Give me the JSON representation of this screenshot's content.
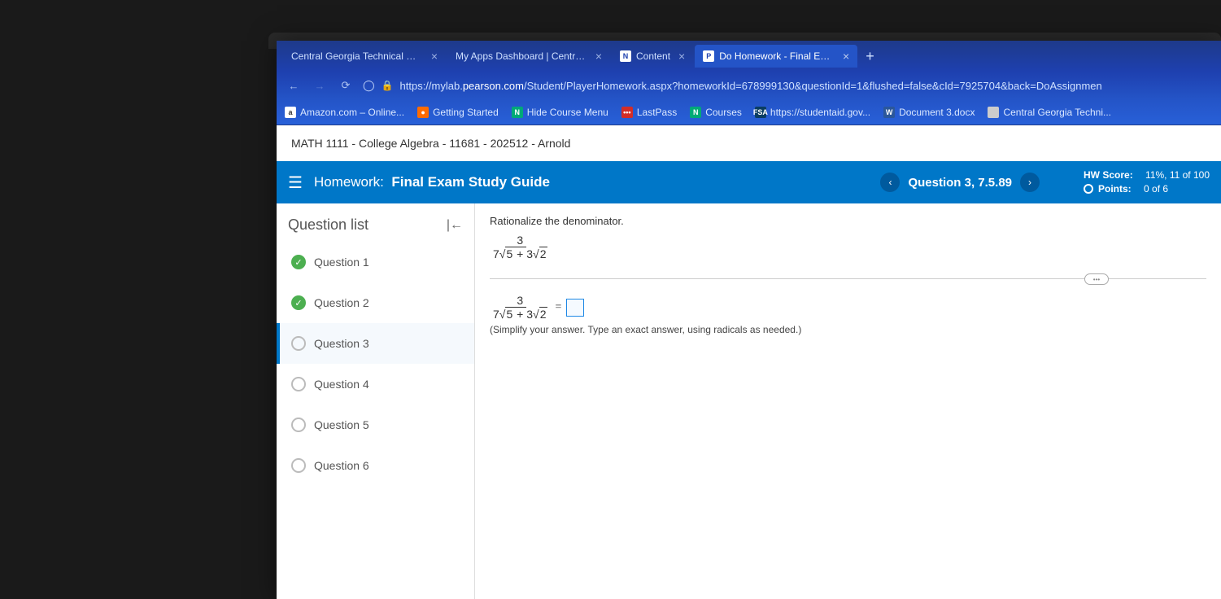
{
  "browser": {
    "tabs": [
      {
        "label": "Central Georgia Technical Colle",
        "fav": "",
        "active": false
      },
      {
        "label": "My Apps Dashboard | Central G",
        "fav": "",
        "active": false
      },
      {
        "label": "Content",
        "fav": "N",
        "active": false
      },
      {
        "label": "Do Homework - Final Exam Stu",
        "fav": "P",
        "active": true
      }
    ],
    "url_prefix": "https://mylab.",
    "url_domain": "pearson.com",
    "url_path": "/Student/PlayerHomework.aspx?homeworkId=678999130&questionId=1&flushed=false&cId=7925704&back=DoAssignmen",
    "bookmarks": [
      {
        "label": "Amazon.com – Online...",
        "ico": "a",
        "bg": "#fff",
        "fg": "#333"
      },
      {
        "label": "Getting Started",
        "ico": "●",
        "bg": "#ff6b00",
        "fg": "#fff"
      },
      {
        "label": "Hide Course Menu",
        "ico": "N",
        "bg": "#0a7",
        "fg": "#fff"
      },
      {
        "label": "LastPass",
        "ico": "•••",
        "bg": "#d32d27",
        "fg": "#fff"
      },
      {
        "label": "Courses",
        "ico": "N",
        "bg": "#0a7",
        "fg": "#fff"
      },
      {
        "label": "https://studentaid.gov...",
        "ico": "FSA",
        "bg": "#0a3d62",
        "fg": "#fff"
      },
      {
        "label": "Document 3.docx",
        "ico": "W",
        "bg": "#2b579a",
        "fg": "#fff"
      },
      {
        "label": "Central Georgia Techni...",
        "ico": "",
        "bg": "#ccc",
        "fg": "#333"
      }
    ]
  },
  "course_header": "MATH 1111 - College Algebra - 11681 - 202512 - Arnold",
  "hw": {
    "prefix": "Homework:",
    "title": "Final Exam Study Guide",
    "question_label": "Question 3, 7.5.89",
    "hw_score_label": "HW Score:",
    "hw_score_value": "11%, 11 of 100",
    "points_label": "Points:",
    "points_value": "0 of 6"
  },
  "sidebar": {
    "title": "Question list",
    "items": [
      {
        "label": "Question 1",
        "status": "done"
      },
      {
        "label": "Question 2",
        "status": "done"
      },
      {
        "label": "Question 3",
        "status": "empty",
        "current": true
      },
      {
        "label": "Question 4",
        "status": "empty"
      },
      {
        "label": "Question 5",
        "status": "empty"
      },
      {
        "label": "Question 6",
        "status": "empty"
      }
    ]
  },
  "problem": {
    "instruction": "Rationalize the denominator.",
    "numerator": "3",
    "den_a": "7",
    "den_r1": "5",
    "den_plus": " + 3",
    "den_r2": "2",
    "equals": " = ",
    "hint": "(Simplify your answer. Type an exact answer, using radicals as needed.)"
  }
}
